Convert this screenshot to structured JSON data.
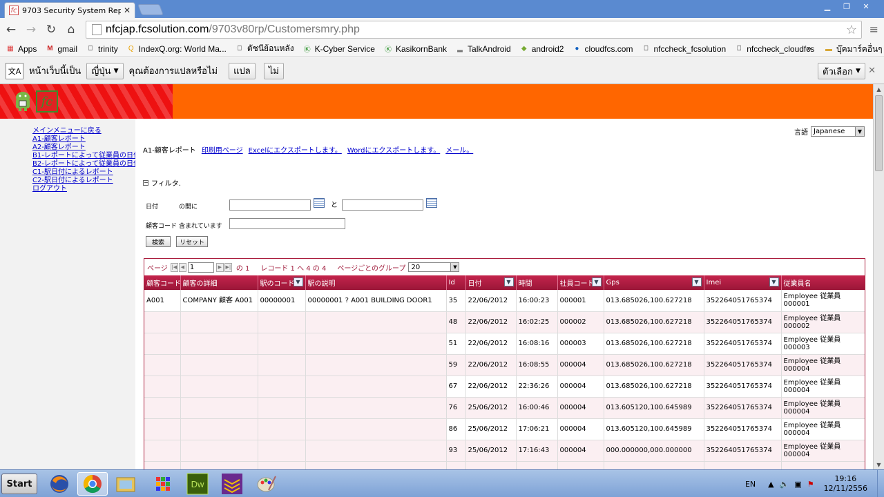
{
  "browser": {
    "tab_title": "9703 Security System Repor",
    "url_host": "nfcjap.fcsolution.com",
    "url_path": "/9703v80rp/Customersmry.php"
  },
  "bookmarks": [
    "Apps",
    "gmail",
    "trinity",
    "IndexQ.org: World Ma...",
    "ตัชนีย้อนหลัง",
    "K-Cyber Service",
    "KasikornBank",
    "TalkAndroid",
    "android2",
    "cloudfcs.com",
    "nfccheck_fcsolution",
    "nfccheck_cloudfcs"
  ],
  "bookmarks_more": "»",
  "bookmarks_folder": "บุ๊คมาร์คอื่นๆ",
  "translate": {
    "prefix": "หน้าเว็บนี้เป็น",
    "language": "ญี่ปุ่น",
    "question": "คุณต้องการแปลหรือไม่",
    "translate_btn": "แปล",
    "no_btn": "ไม่",
    "options_btn": "ตัวเลือก"
  },
  "sidebar": {
    "links": [
      "メインメニューに戻る",
      "A1-顧客レポート",
      "A2-顧客レポート",
      "B1-レポートによって従業員の日付",
      "B2-レポートによって従業員の日付",
      "C1-駅日付によるレポート",
      "C2-駅日付によるレポート",
      "ログアウト"
    ]
  },
  "page": {
    "language_label": "言語",
    "language_value": "Japanese",
    "report_title": "A1-顧客レポート",
    "actions": [
      "印刷用ページ",
      "Excelにエクスポートします。",
      "Wordにエクスポートします。",
      "メール。"
    ],
    "filter_label": "フィルタ.",
    "date_label": "日付",
    "between_label": "の間に",
    "and_label": "と",
    "customer_code_label": "顧客コード",
    "contains_label": "含まれています",
    "search_btn": "検索",
    "reset_btn": "リセット"
  },
  "pager": {
    "page_label": "ページ",
    "page_value": "1",
    "of_label": "の 1",
    "records_label": "レコード 1 へ 4 の 4",
    "group_label": "ページごとのグループ",
    "page_size": "20"
  },
  "grid": {
    "columns": [
      "顧客コード",
      "顧客の詳細",
      "駅のコード",
      "駅の説明",
      "Id",
      "日付",
      "時間",
      "社員コード",
      "Gps",
      "Imei",
      "従業員名"
    ],
    "group": {
      "customer_code": "A001",
      "customer_detail": "COMPANY 顧客 A001",
      "station_code": "00000001",
      "station_desc": "00000001 ? A001 BUILDING DOOR1"
    },
    "rows": [
      [
        "35",
        "22/06/2012",
        "16:00:23",
        "000001",
        "013.685026,100.627218",
        "352264051765374",
        "Employee 従業員 000001"
      ],
      [
        "48",
        "22/06/2012",
        "16:02:25",
        "000002",
        "013.685026,100.627218",
        "352264051765374",
        "Employee 従業員 000002"
      ],
      [
        "51",
        "22/06/2012",
        "16:08:16",
        "000003",
        "013.685026,100.627218",
        "352264051765374",
        "Employee 従業員 000003"
      ],
      [
        "59",
        "22/06/2012",
        "16:08:55",
        "000004",
        "013.685026,100.627218",
        "352264051765374",
        "Employee 従業員 000004"
      ],
      [
        "67",
        "22/06/2012",
        "22:36:26",
        "000004",
        "013.685026,100.627218",
        "352264051765374",
        "Employee 従業員 000004"
      ],
      [
        "76",
        "25/06/2012",
        "16:00:46",
        "000004",
        "013.605120,100.645989",
        "352264051765374",
        "Employee 従業員 000004"
      ],
      [
        "86",
        "25/06/2012",
        "17:06:21",
        "000004",
        "013.605120,100.645989",
        "352264051765374",
        "Employee 従業員 000004"
      ],
      [
        "93",
        "25/06/2012",
        "17:16:43",
        "000004",
        "000.000000,000.000000",
        "352264051765374",
        "Employee 従業員 000004"
      ]
    ]
  },
  "taskbar": {
    "start_label": "Start",
    "lang": "EN",
    "time": "19:16",
    "date": "12/11/2556"
  }
}
